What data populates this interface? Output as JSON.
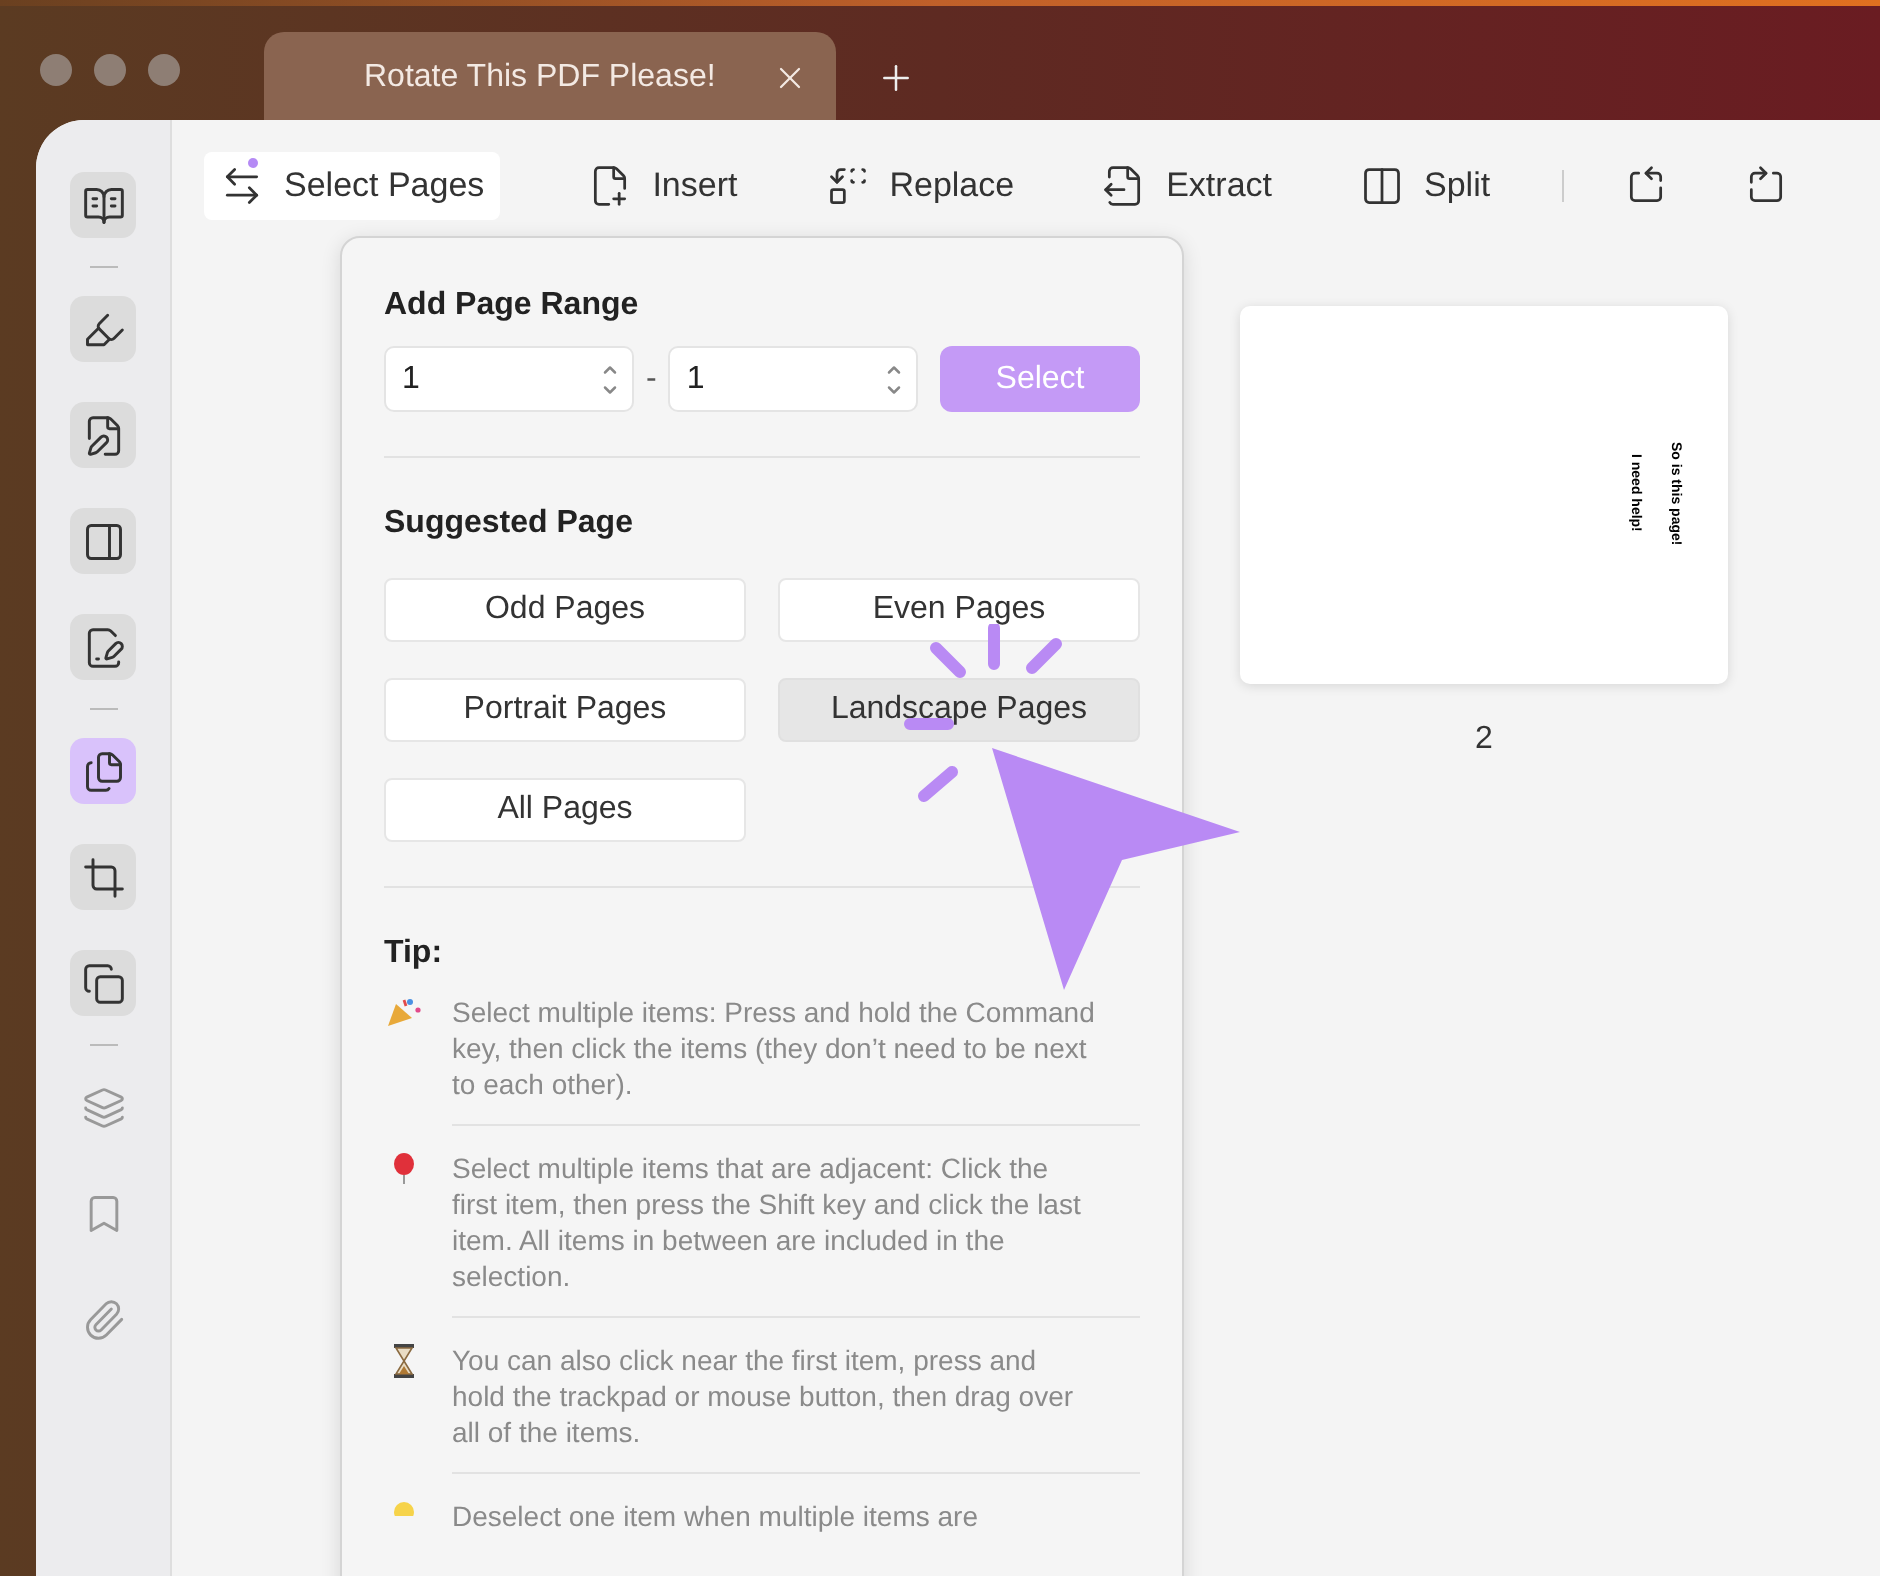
{
  "tab": {
    "title": "Rotate This PDF Please!"
  },
  "sidebar": {
    "groups": [
      [
        {
          "kind": "reader",
          "selected": false
        }
      ],
      [
        {
          "kind": "highlight",
          "selected": false
        },
        {
          "kind": "edit",
          "selected": false
        },
        {
          "kind": "form",
          "selected": false
        },
        {
          "kind": "sign",
          "selected": false
        }
      ],
      [
        {
          "kind": "organize",
          "selected": true
        },
        {
          "kind": "crop",
          "selected": false
        },
        {
          "kind": "combine",
          "selected": false
        }
      ],
      [
        {
          "kind": "layers",
          "selected": false
        },
        {
          "kind": "bookmark",
          "selected": false
        },
        {
          "kind": "attach",
          "selected": false
        }
      ]
    ]
  },
  "toolbar": [
    {
      "kind": "select",
      "label": "Select Pages",
      "selected": true
    },
    {
      "kind": "insert",
      "label": "Insert",
      "selected": false
    },
    {
      "kind": "replace",
      "label": "Replace",
      "selected": false
    },
    {
      "kind": "extract",
      "label": "Extract",
      "selected": false
    },
    {
      "kind": "split",
      "label": "Split",
      "selected": false
    },
    {
      "kind": "rotate-left",
      "selected": false
    },
    {
      "kind": "rotate-right",
      "selected": false
    }
  ],
  "popover": {
    "range": {
      "title": "Add Page Range",
      "from": "1",
      "separator": "-",
      "to": "1",
      "button": "Select"
    },
    "suggested": {
      "title": "Suggested Page",
      "options": [
        {
          "label": "Odd Pages",
          "selected": false
        },
        {
          "label": "Even Pages",
          "selected": false
        },
        {
          "label": "Portrait Pages",
          "selected": false
        },
        {
          "label": "Landscape Pages",
          "selected": true
        },
        {
          "label": "All Pages",
          "selected": false
        }
      ]
    },
    "tips": {
      "title": "Tip:",
      "items": [
        {
          "kind": "party",
          "text": "Select multiple items: Press and hold the Command key, then click the items (they don’t need to be next to each other)."
        },
        {
          "kind": "balloon",
          "text": "Select multiple items that are adjacent: Click the first item, then press the Shift key and click the last item. All items in between are included in the selection."
        },
        {
          "kind": "hourglass",
          "text": "You can also click near the first item, press and hold the trackpad or mouse button, then drag over all of the items."
        },
        {
          "kind": "bulb",
          "text": "Deselect one item when multiple items are"
        }
      ]
    }
  },
  "page": {
    "lines": [
      "So is this page!",
      "I need help!"
    ],
    "number": "2"
  }
}
